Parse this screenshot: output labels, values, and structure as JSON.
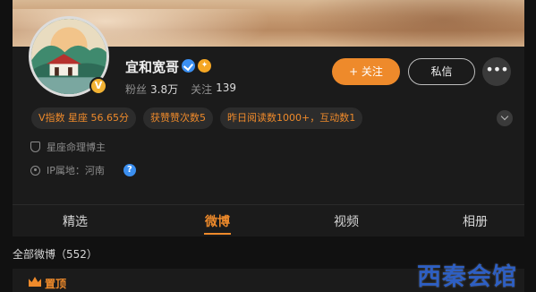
{
  "profile": {
    "name": "宜和宽哥",
    "avatar_badge": "V",
    "fans_label": "粉丝",
    "fans_count": "3.8万",
    "follow_label": "关注",
    "follow_count": "139"
  },
  "actions": {
    "follow_label": "+ 关注",
    "message_label": "私信",
    "more_label": "•••"
  },
  "tags": [
    "V指数 星座 56.65分",
    "获赞赞次数5",
    "昨日阅读数1000+，互动数1"
  ],
  "info": {
    "category": "星座命理博主",
    "ip_location": "IP属地：河南",
    "help_mark": "?"
  },
  "tabs": [
    "精选",
    "微博",
    "视频",
    "相册"
  ],
  "active_tab": "微博",
  "feed": {
    "all_label": "全部微博（552）",
    "pinned_label": "置顶"
  },
  "watermark": "西秦会馆",
  "colors": {
    "accent": "#ee8a2b",
    "verified_blue": "#3b8ff0",
    "background": "#111111",
    "card": "#1b1b1b"
  }
}
